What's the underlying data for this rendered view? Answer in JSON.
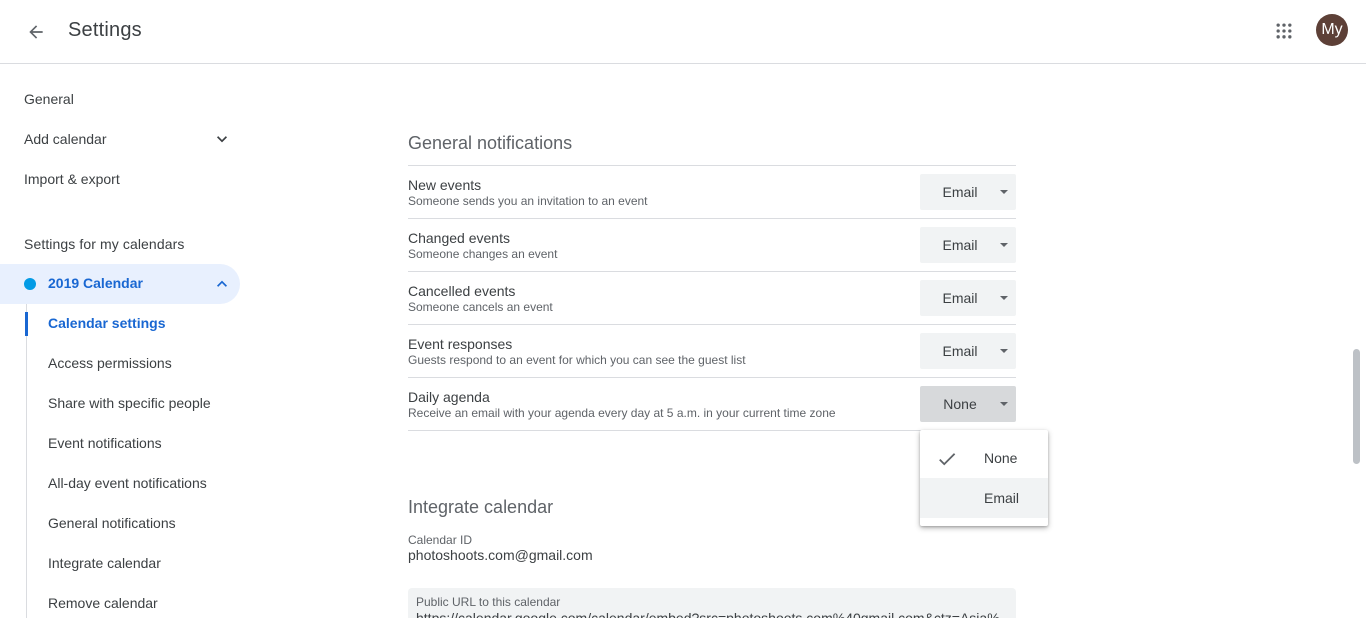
{
  "header": {
    "title": "Settings",
    "avatar_initials": "My",
    "icons": {
      "back": "arrow-back-icon",
      "apps": "apps-grid-icon"
    }
  },
  "sidebar": {
    "top_items": [
      {
        "label": "General"
      },
      {
        "label": "Add calendar",
        "icon": "chevron-down-icon"
      },
      {
        "label": "Import & export"
      }
    ],
    "section_title": "Settings for my calendars",
    "calendar": {
      "label": "2019 Calendar",
      "color": "#039be5",
      "icon": "chevron-up-icon"
    },
    "sub_items": [
      {
        "label": "Calendar settings"
      },
      {
        "label": "Access permissions"
      },
      {
        "label": "Share with specific people"
      },
      {
        "label": "Event notifications"
      },
      {
        "label": "All-day event notifications"
      },
      {
        "label": "General notifications"
      },
      {
        "label": "Integrate calendar"
      },
      {
        "label": "Remove calendar"
      }
    ],
    "active_sub_item": "Calendar settings"
  },
  "general_notifications": {
    "title": "General notifications",
    "rows": [
      {
        "title": "New events",
        "description": "Someone sends you an invitation to an event",
        "value": "Email"
      },
      {
        "title": "Changed events",
        "description": "Someone changes an event",
        "value": "Email"
      },
      {
        "title": "Cancelled events",
        "description": "Someone cancels an event",
        "value": "Email"
      },
      {
        "title": "Event responses",
        "description": "Guests respond to an event for which you can see the guest list",
        "value": "Email"
      },
      {
        "title": "Daily agenda",
        "description": "Receive an email with your agenda every day at 5 a.m. in your current time zone",
        "value": "None"
      }
    ]
  },
  "dropdown_menu": {
    "options": [
      {
        "label": "None",
        "selected": true,
        "icon": "checkmark-icon"
      },
      {
        "label": "Email",
        "selected": false
      }
    ]
  },
  "integrate_calendar": {
    "title": "Integrate calendar",
    "calendar_id_label": "Calendar ID",
    "calendar_id": "photoshoots.com@gmail.com",
    "public_url_label": "Public URL to this calendar",
    "public_url": "https://calendar.google.com/calendar/embed?src=photoshoots.com%40gmail.com&ctz=Asia%"
  },
  "colors": {
    "accent": "#1967d2",
    "active_bg": "#e8f0fe",
    "avatar_bg": "#5d4037"
  }
}
